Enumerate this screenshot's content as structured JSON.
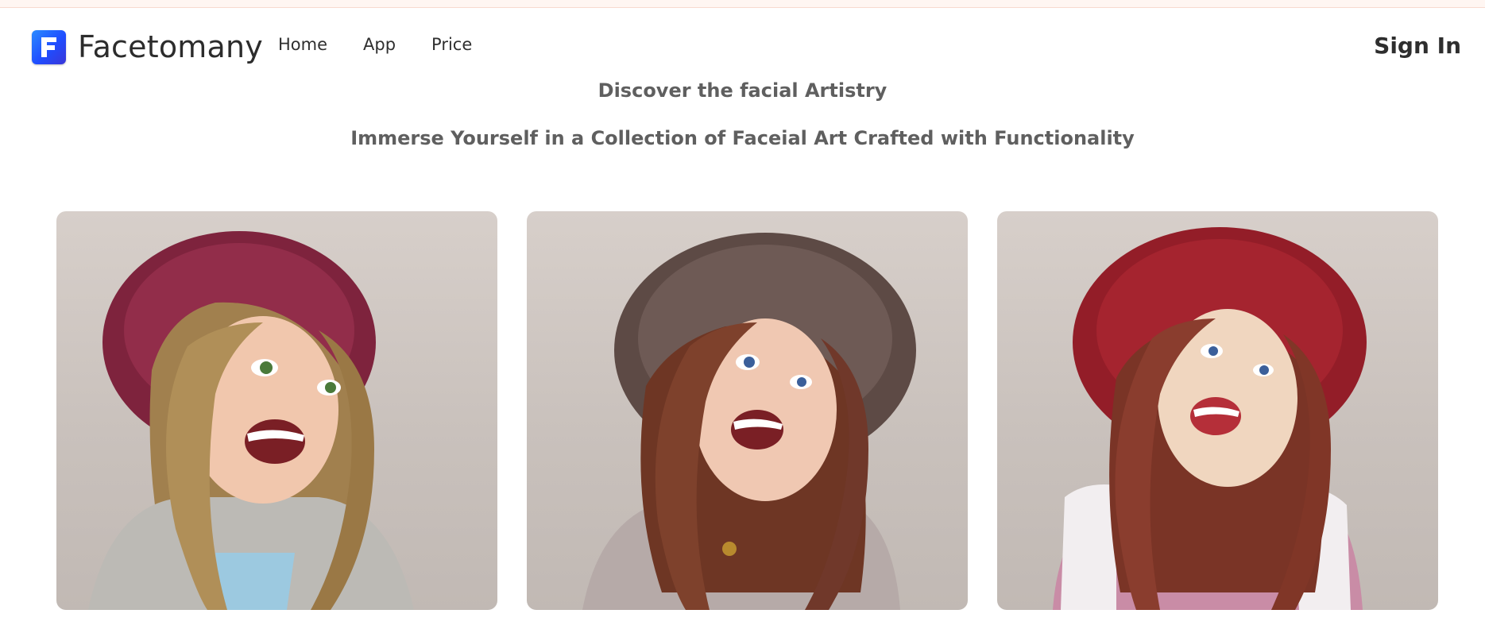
{
  "brand": {
    "name": "Facetomany",
    "logo_letter": "F"
  },
  "nav": {
    "items": [
      "Home",
      "App",
      "Price"
    ]
  },
  "auth": {
    "signin_label": "Sign In"
  },
  "hero": {
    "title": "Discover the facial Artistry",
    "subtitle": "Immerse Yourself in a Collection of Faceial Art Crafted with Functionality"
  },
  "gallery": {
    "cards": [
      {
        "hat_color": "#8e2a46",
        "hair_color": "#9a7a4a",
        "clothing_color": "#b9b7b2",
        "style": "cartoon"
      },
      {
        "hat_color": "#6e5a55",
        "hair_color": "#7a3f2b",
        "clothing_color": "#b6aaa8",
        "style": "clay"
      },
      {
        "hat_color": "#a5242f",
        "hair_color": "#8a3d2e",
        "clothing_color": "#c98ca6",
        "style": "figurine"
      }
    ]
  },
  "colors": {
    "accent": "#1f4dff",
    "text_dark": "#2e2e2e",
    "text_muted": "#5f5f5f"
  }
}
